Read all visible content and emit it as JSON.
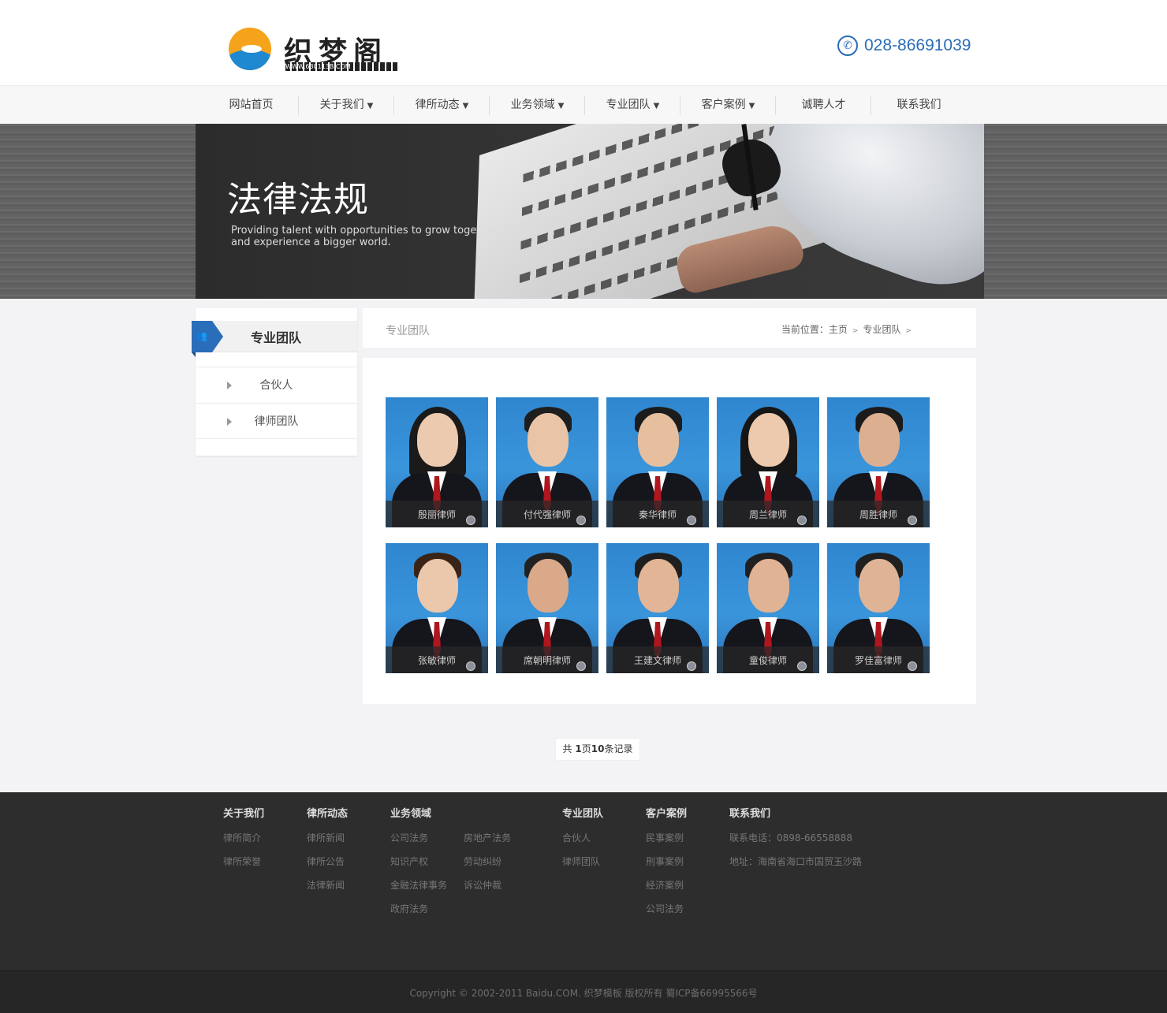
{
  "header": {
    "logo_text": "织梦阁",
    "logo_sub": "WWW.630113B.COM",
    "phone": "028-86691039"
  },
  "nav": [
    {
      "label": "网站首页",
      "arrow": ""
    },
    {
      "label": "关于我们",
      "arrow": "▼"
    },
    {
      "label": "律所动态",
      "arrow": "▼"
    },
    {
      "label": "业务领域",
      "arrow": "▼"
    },
    {
      "label": "专业团队",
      "arrow": "▼"
    },
    {
      "label": "客户案例",
      "arrow": "▼"
    },
    {
      "label": "诚聘人才",
      "arrow": ""
    },
    {
      "label": "联系我们",
      "arrow": ""
    }
  ],
  "banner": {
    "title": "法律法规",
    "subtitle": "Providing talent with opportunities to grow together and experience a bigger world."
  },
  "sidebar": {
    "title": "专业团队",
    "items": [
      "合伙人",
      "律师团队"
    ]
  },
  "crumb": {
    "title": "专业团队",
    "prefix": "当前位置：",
    "home": "主页",
    "current": "专业团队",
    "sep": ">"
  },
  "team": [
    {
      "name": "殷丽律师",
      "hair": "#1a1a1a",
      "skin": "#eccab0",
      "long": true
    },
    {
      "name": "付代强律师",
      "hair": "#1e1e1e",
      "skin": "#e9c4a6",
      "long": false
    },
    {
      "name": "秦华律师",
      "hair": "#1c1c1c",
      "skin": "#e6bf9f",
      "long": false
    },
    {
      "name": "周兰律师",
      "hair": "#161616",
      "skin": "#edc9ad",
      "long": true
    },
    {
      "name": "周胜律师",
      "hair": "#1b1b1b",
      "skin": "#dcaf90",
      "long": false
    },
    {
      "name": "张敏律师",
      "hair": "#3a2418",
      "skin": "#ebc7ab",
      "long": false
    },
    {
      "name": "席朝明律师",
      "hair": "#222222",
      "skin": "#d9a98a",
      "long": false
    },
    {
      "name": "王建文律师",
      "hair": "#1f1f1f",
      "skin": "#e2b597",
      "long": false
    },
    {
      "name": "童俊律师",
      "hair": "#202020",
      "skin": "#e0b394",
      "long": false
    },
    {
      "name": "罗佳富律师",
      "hair": "#202020",
      "skin": "#dfb496",
      "long": false
    }
  ],
  "pager": {
    "prefix": "共 ",
    "pages": "1",
    "mid": "页",
    "records": "10",
    "suffix": "条记录"
  },
  "footer": {
    "cols": [
      {
        "head": "关于我们",
        "links": [
          "律所简介",
          "律所荣誉"
        ]
      },
      {
        "head": "律所动态",
        "links": [
          "律所新闻",
          "律所公告",
          "法律新闻"
        ]
      },
      {
        "head": "业务领域",
        "links": [
          "公司法务",
          "知识产权",
          "金融法律事务",
          "政府法务"
        ]
      },
      {
        "head": "",
        "links": [
          "房地产法务",
          "劳动纠纷",
          "诉讼仲裁"
        ]
      },
      {
        "head": "专业团队",
        "links": [
          "合伙人",
          "律师团队"
        ]
      },
      {
        "head": "客户案例",
        "links": [
          "民事案例",
          "刑事案例",
          "经济案例",
          "公司法务"
        ]
      },
      {
        "head": "联系我们",
        "links": [
          "联系电话：0898-66558888",
          "地址：海南省海口市国贸玉沙路"
        ]
      }
    ],
    "copyright": "Copyright © 2002-2011 Baidu.COM. 织梦模板 版权所有 蜀ICP备66995566号"
  },
  "colors": {
    "accent": "#2a6db8",
    "footer_bg": "#2d2d2d"
  }
}
